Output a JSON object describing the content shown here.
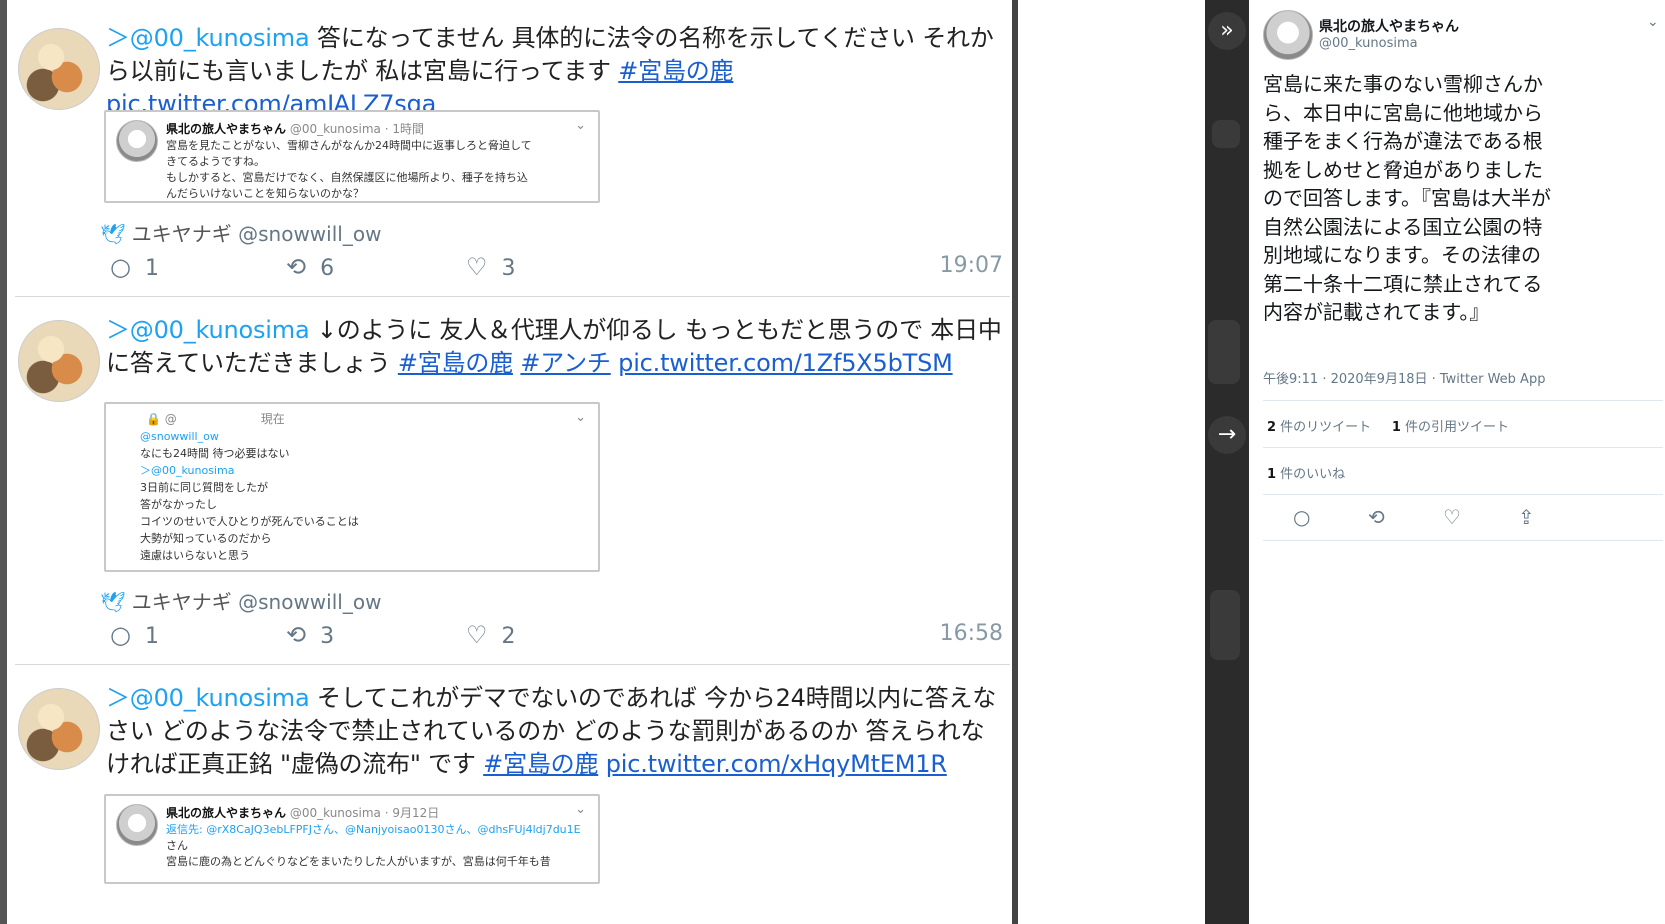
{
  "left_feed": {
    "tweets": [
      {
        "mention": "＞@00_kunosima",
        "text": " 答になってません 具体的に法令の名称を示してください それから以前にも言いましたが 私は宮島に行ってます ",
        "hashtag1": "#宮島の鹿",
        "hashtag2": "",
        "link": "pic.twitter.com/amJALZ7sqa",
        "quote": {
          "name": "県北の旅人やまちゃん",
          "meta": "@00_kunosima · 1時間",
          "lines": [
            "宮島を見たことがない、雪柳さんがなんか24時間中に返事しろと脅迫して",
            "きてるようですね。",
            "もしかすると、宮島だけでなく、自然保護区に他場所より、種子を持ち込",
            "んだらいけないことを知らないのかな？"
          ]
        },
        "credit_name": "ユキヤナギ",
        "credit_handle": "@snowwill_ow",
        "replies": "1",
        "retweets": "6",
        "likes": "3",
        "time": "19:07"
      },
      {
        "mention": "＞@00_kunosima",
        "text": " ↓のように 友人＆代理人が仰るし もっともだと思うので 本日中に答えていただきましょう ",
        "hashtag1": "#宮島の鹿",
        "hashtag2": "#アンチ",
        "link": "pic.twitter.com/1Zf5X5bTSM",
        "quote": {
          "header": "🔒 @　　　　　　　現在",
          "lines": [
            "@snowwill_ow",
            "なにも24時間 待つ必要はない",
            "＞@00_kunosima",
            "3日前に同じ質問をしたが",
            "答がなかったし",
            "コイツのせいで人ひとりが死んでいることは",
            "大勢が知っているのだから",
            "遠慮はいらないと思う"
          ]
        },
        "credit_name": "ユキヤナギ",
        "credit_handle": "@snowwill_ow",
        "replies": "1",
        "retweets": "3",
        "likes": "2",
        "time": "16:58"
      },
      {
        "mention": "＞@00_kunosima",
        "text": " そしてこれがデマでないのであれば 今から24時間以内に答えなさい どのような法令で禁止されているのか どのような罰則があるのか 答えられなければ正真正銘 \"虚偽の流布\" です ",
        "hashtag1": "#宮島の鹿",
        "hashtag2": "",
        "link": "pic.twitter.com/xHqyMtEM1R",
        "quote": {
          "name": "県北の旅人やまちゃん",
          "meta": "@00_kunosima · 9月12日",
          "lines": [
            "返信先: @rX8CaJQ3ebLFPFJさん、@Nanjyoisao0130さん、@dhsFUj4ldj7du1E",
            "さん",
            "宮島に鹿の為とどんぐりなどをまいたりした人がいますが、宮島は何千年も昔"
          ]
        }
      }
    ]
  },
  "right_panel": {
    "name": "県北の旅人やまちゃん",
    "handle": "@00_kunosima",
    "text": "宮島に来た事のない雪柳さんから、本日中に宮島に他地域から種子をまく行為が違法である根拠をしめせと脅迫がありましたので回答します。『宮島は大半が自然公園法による国立公園の特別地域になります。その法律の第二十条十二項に禁止されてる内容が記載されてます。』",
    "meta": "午後9:11 · 2020年9月18日 · Twitter Web App",
    "retweets_count": "2",
    "retweets_label": " 件のリツイート",
    "quotes_count": "1",
    "quotes_label": " 件の引用ツイート",
    "likes_count": "1",
    "likes_label": " 件のいいね"
  },
  "icons": {
    "reply": "reply-icon",
    "retweet": "retweet-icon",
    "like": "heart-icon",
    "share": "share-icon",
    "bird": "twitter-bird-icon",
    "expand": "double-chevron-icon",
    "arrow": "arrow-right-icon",
    "caret": "chevron-down-icon"
  },
  "colors": {
    "twitter_blue": "#1da1f2",
    "link_blue": "#1a5fd1",
    "gray_text": "#657786"
  }
}
